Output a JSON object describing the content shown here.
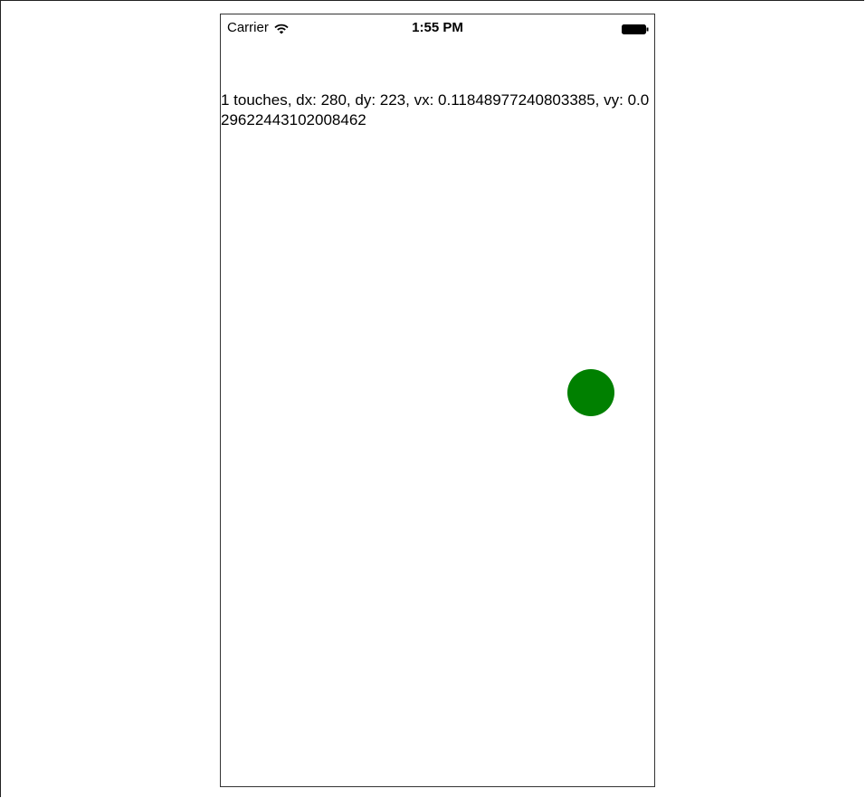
{
  "status_bar": {
    "carrier": "Carrier",
    "time": "1:55 PM",
    "wifi_icon": "wifi-icon",
    "battery_icon": "battery-icon"
  },
  "touch_info": {
    "text": "1 touches, dx: 280, dy: 223, vx: 0.11848977240803385, vy: 0.029622443102008462"
  },
  "touch_indicator": {
    "color": "#008000"
  }
}
